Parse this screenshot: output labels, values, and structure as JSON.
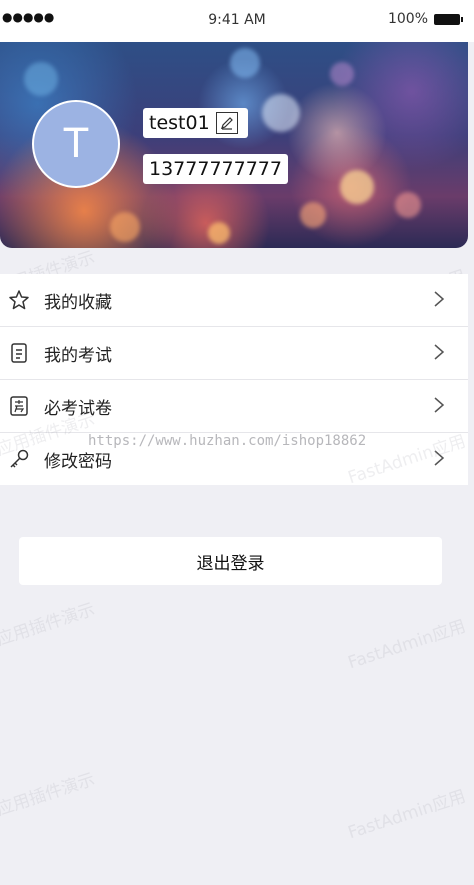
{
  "status_bar": {
    "signal": "●●●●●",
    "time": "9:41 AM",
    "battery": "100%"
  },
  "profile": {
    "avatar_letter": "T",
    "username": "test01",
    "phone": "13777777777"
  },
  "menu": [
    {
      "label": "我的收藏",
      "icon": "star-icon"
    },
    {
      "label": "我的考试",
      "icon": "document-icon"
    },
    {
      "label": "必考试卷",
      "icon": "exam-icon"
    },
    {
      "label": "修改密码",
      "icon": "key-icon"
    }
  ],
  "logout_label": "退出登录",
  "watermarks": {
    "left": "应用插件演示",
    "right": "FastAdmin应用",
    "url": "https://www.huzhan.com/ishop18862"
  },
  "colors": {
    "background": "#efeff4",
    "avatar": "#9cb3e3"
  }
}
